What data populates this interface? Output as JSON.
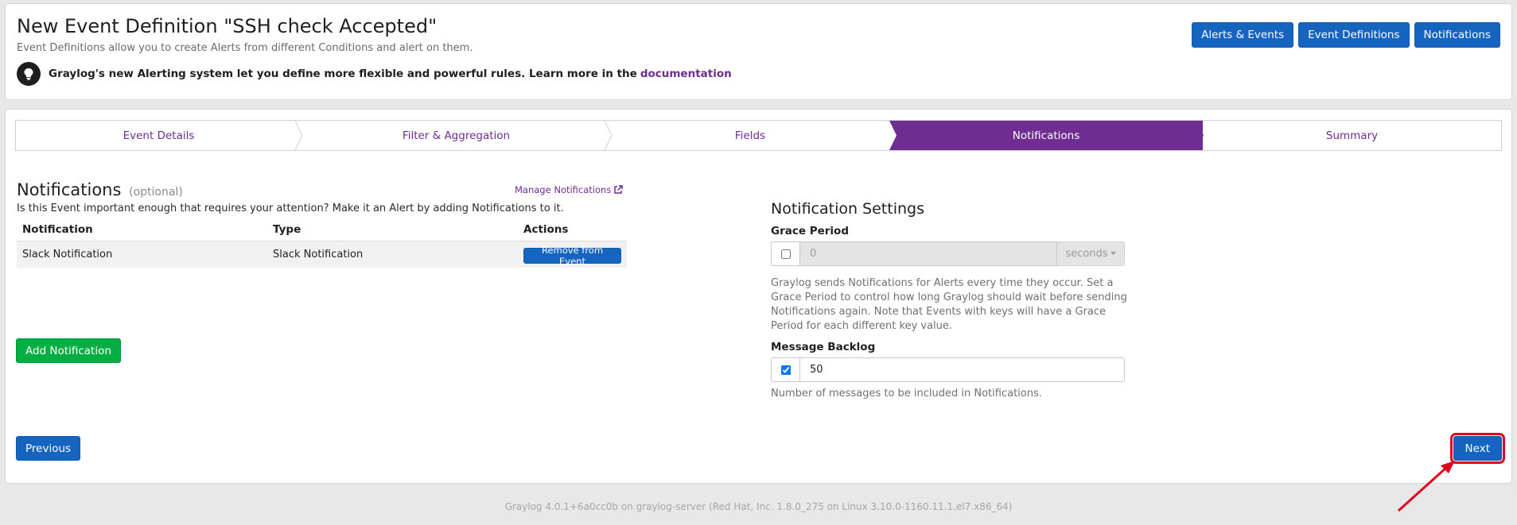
{
  "header": {
    "title": "New Event Definition \"SSH check Accepted\"",
    "description": "Event Definitions allow you to create Alerts from different Conditions and alert on them.",
    "tip_text": "Graylog's new Alerting system let you define more flexible and powerful rules. Learn more in the",
    "tip_link": "documentation",
    "buttons": [
      "Alerts & Events",
      "Event Definitions",
      "Notifications"
    ]
  },
  "wizard": {
    "steps": [
      "Event Details",
      "Filter & Aggregation",
      "Fields",
      "Notifications",
      "Summary"
    ],
    "active_step": "Notifications"
  },
  "notifications": {
    "heading": "Notifications",
    "optional_label": "(optional)",
    "manage_link": "Manage Notifications",
    "intro": "Is this Event important enough that requires your attention? Make it an Alert by adding Notifications to it.",
    "columns": [
      "Notification",
      "Type",
      "Actions"
    ],
    "rows": [
      {
        "notification": "Slack Notification",
        "type": "Slack Notification",
        "action": "Remove from Event"
      }
    ],
    "add_button": "Add Notification"
  },
  "settings": {
    "title": "Notification Settings",
    "grace_period": {
      "label": "Grace Period",
      "enabled": false,
      "value": "0",
      "unit": "seconds"
    },
    "grace_help": "Graylog sends Notifications for Alerts every time they occur. Set a Grace Period to control how long Graylog should wait before sending Notifications again. Note that Events with keys will have a Grace Period for each different key value.",
    "backlog": {
      "label": "Message Backlog",
      "enabled": true,
      "value": "50"
    },
    "backlog_help": "Number of messages to be included in Notifications."
  },
  "nav": {
    "previous": "Previous",
    "next": "Next"
  },
  "footer": "Graylog 4.0.1+6a0cc0b on graylog-server (Red Hat, Inc. 1.8.0_275 on Linux 3.10.0-1160.11.1.el7.x86_64)",
  "colors": {
    "primary": "#1565c0",
    "accent": "#6f2c91",
    "success": "#00ae42",
    "highlight": "#e0001b"
  }
}
